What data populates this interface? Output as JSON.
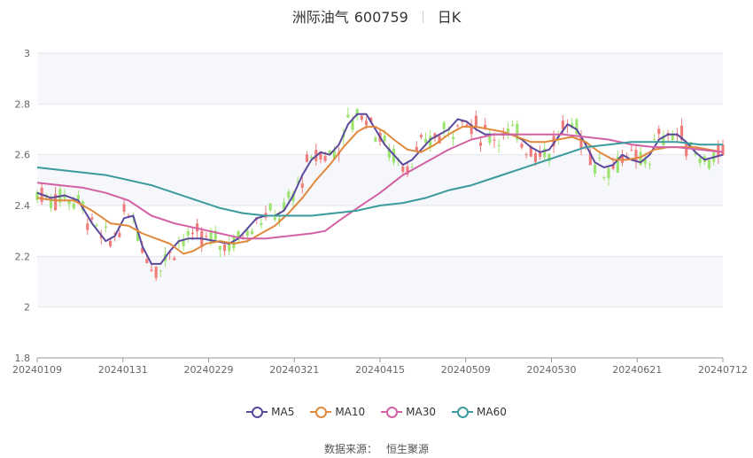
{
  "header": {
    "name": "洲际油气",
    "code": "600759",
    "period": "日K"
  },
  "source": {
    "label": "数据来源：",
    "value": "恒生聚源"
  },
  "chart_data": {
    "type": "candlestick",
    "title": "洲际油气 600759",
    "ylim": [
      1.8,
      3.0
    ],
    "yticks": [
      "1.8",
      "2",
      "2.2",
      "2.4",
      "2.6",
      "2.8",
      "3"
    ],
    "xticks": [
      "20240109",
      "20240131",
      "20240229",
      "20240321",
      "20240415",
      "20240509",
      "20240530",
      "20240621",
      "20240712"
    ],
    "grid": true,
    "legend_position": "bottom",
    "up_color": "#f07b7b",
    "down_color": "#9ce36d",
    "series": [
      {
        "name": "MA5",
        "color": "#5b4a9c",
        "points": [
          [
            0,
            2.45
          ],
          [
            3,
            2.43
          ],
          [
            6,
            2.44
          ],
          [
            9,
            2.42
          ],
          [
            12,
            2.33
          ],
          [
            15,
            2.26
          ],
          [
            17,
            2.28
          ],
          [
            19,
            2.35
          ],
          [
            21,
            2.36
          ],
          [
            23,
            2.24
          ],
          [
            25,
            2.17
          ],
          [
            27,
            2.17
          ],
          [
            29,
            2.22
          ],
          [
            31,
            2.26
          ],
          [
            33,
            2.27
          ],
          [
            36,
            2.27
          ],
          [
            39,
            2.26
          ],
          [
            42,
            2.25
          ],
          [
            44,
            2.27
          ],
          [
            46,
            2.31
          ],
          [
            48,
            2.35
          ],
          [
            50,
            2.36
          ],
          [
            52,
            2.36
          ],
          [
            54,
            2.38
          ],
          [
            56,
            2.44
          ],
          [
            58,
            2.52
          ],
          [
            60,
            2.58
          ],
          [
            62,
            2.61
          ],
          [
            64,
            2.6
          ],
          [
            66,
            2.64
          ],
          [
            68,
            2.72
          ],
          [
            70,
            2.76
          ],
          [
            72,
            2.76
          ],
          [
            74,
            2.7
          ],
          [
            76,
            2.64
          ],
          [
            78,
            2.6
          ],
          [
            80,
            2.56
          ],
          [
            82,
            2.58
          ],
          [
            84,
            2.62
          ],
          [
            86,
            2.66
          ],
          [
            88,
            2.68
          ],
          [
            90,
            2.7
          ],
          [
            92,
            2.74
          ],
          [
            94,
            2.73
          ],
          [
            96,
            2.7
          ],
          [
            98,
            2.68
          ],
          [
            100,
            2.68
          ],
          [
            102,
            2.68
          ],
          [
            104,
            2.68
          ],
          [
            106,
            2.66
          ],
          [
            108,
            2.63
          ],
          [
            110,
            2.61
          ],
          [
            112,
            2.62
          ],
          [
            114,
            2.67
          ],
          [
            116,
            2.72
          ],
          [
            118,
            2.7
          ],
          [
            120,
            2.64
          ],
          [
            122,
            2.57
          ],
          [
            124,
            2.55
          ],
          [
            126,
            2.56
          ],
          [
            128,
            2.6
          ],
          [
            130,
            2.58
          ],
          [
            132,
            2.57
          ],
          [
            134,
            2.6
          ],
          [
            136,
            2.66
          ],
          [
            138,
            2.68
          ],
          [
            140,
            2.68
          ],
          [
            142,
            2.65
          ],
          [
            144,
            2.61
          ],
          [
            146,
            2.58
          ],
          [
            148,
            2.59
          ],
          [
            150,
            2.6
          ]
        ]
      },
      {
        "name": "MA10",
        "color": "#e0893d",
        "points": [
          [
            0,
            2.43
          ],
          [
            4,
            2.42
          ],
          [
            8,
            2.42
          ],
          [
            12,
            2.38
          ],
          [
            16,
            2.33
          ],
          [
            20,
            2.32
          ],
          [
            23,
            2.29
          ],
          [
            26,
            2.27
          ],
          [
            29,
            2.25
          ],
          [
            32,
            2.21
          ],
          [
            34,
            2.22
          ],
          [
            37,
            2.25
          ],
          [
            40,
            2.26
          ],
          [
            43,
            2.25
          ],
          [
            46,
            2.26
          ],
          [
            49,
            2.29
          ],
          [
            52,
            2.32
          ],
          [
            55,
            2.37
          ],
          [
            58,
            2.43
          ],
          [
            61,
            2.5
          ],
          [
            64,
            2.56
          ],
          [
            67,
            2.63
          ],
          [
            70,
            2.69
          ],
          [
            72,
            2.71
          ],
          [
            74,
            2.71
          ],
          [
            76,
            2.69
          ],
          [
            78,
            2.66
          ],
          [
            81,
            2.62
          ],
          [
            84,
            2.61
          ],
          [
            87,
            2.64
          ],
          [
            90,
            2.68
          ],
          [
            93,
            2.71
          ],
          [
            96,
            2.71
          ],
          [
            99,
            2.7
          ],
          [
            102,
            2.69
          ],
          [
            105,
            2.67
          ],
          [
            108,
            2.65
          ],
          [
            111,
            2.65
          ],
          [
            114,
            2.66
          ],
          [
            117,
            2.67
          ],
          [
            120,
            2.65
          ],
          [
            123,
            2.61
          ],
          [
            126,
            2.58
          ],
          [
            129,
            2.58
          ],
          [
            132,
            2.59
          ],
          [
            135,
            2.62
          ],
          [
            138,
            2.63
          ],
          [
            141,
            2.63
          ],
          [
            144,
            2.63
          ],
          [
            147,
            2.62
          ],
          [
            150,
            2.61
          ]
        ]
      },
      {
        "name": "MA30",
        "color": "#d361a4",
        "points": [
          [
            0,
            2.49
          ],
          [
            5,
            2.48
          ],
          [
            10,
            2.47
          ],
          [
            15,
            2.45
          ],
          [
            20,
            2.42
          ],
          [
            25,
            2.36
          ],
          [
            30,
            2.33
          ],
          [
            35,
            2.31
          ],
          [
            40,
            2.29
          ],
          [
            45,
            2.27
          ],
          [
            50,
            2.27
          ],
          [
            55,
            2.28
          ],
          [
            60,
            2.29
          ],
          [
            63,
            2.3
          ],
          [
            66,
            2.34
          ],
          [
            70,
            2.39
          ],
          [
            75,
            2.45
          ],
          [
            80,
            2.52
          ],
          [
            85,
            2.57
          ],
          [
            90,
            2.62
          ],
          [
            95,
            2.66
          ],
          [
            100,
            2.68
          ],
          [
            105,
            2.68
          ],
          [
            110,
            2.68
          ],
          [
            115,
            2.68
          ],
          [
            120,
            2.67
          ],
          [
            125,
            2.66
          ],
          [
            130,
            2.64
          ],
          [
            135,
            2.63
          ],
          [
            140,
            2.63
          ],
          [
            145,
            2.62
          ],
          [
            150,
            2.61
          ]
        ]
      },
      {
        "name": "MA60",
        "color": "#3a9a9c",
        "points": [
          [
            0,
            2.55
          ],
          [
            5,
            2.54
          ],
          [
            10,
            2.53
          ],
          [
            15,
            2.52
          ],
          [
            20,
            2.5
          ],
          [
            25,
            2.48
          ],
          [
            30,
            2.45
          ],
          [
            35,
            2.42
          ],
          [
            40,
            2.39
          ],
          [
            45,
            2.37
          ],
          [
            50,
            2.36
          ],
          [
            55,
            2.36
          ],
          [
            60,
            2.36
          ],
          [
            65,
            2.37
          ],
          [
            70,
            2.38
          ],
          [
            75,
            2.4
          ],
          [
            80,
            2.41
          ],
          [
            85,
            2.43
          ],
          [
            90,
            2.46
          ],
          [
            95,
            2.48
          ],
          [
            100,
            2.51
          ],
          [
            105,
            2.54
          ],
          [
            110,
            2.57
          ],
          [
            115,
            2.6
          ],
          [
            120,
            2.63
          ],
          [
            125,
            2.64
          ],
          [
            130,
            2.65
          ],
          [
            135,
            2.65
          ],
          [
            140,
            2.65
          ],
          [
            145,
            2.64
          ],
          [
            150,
            2.64
          ]
        ]
      }
    ]
  }
}
